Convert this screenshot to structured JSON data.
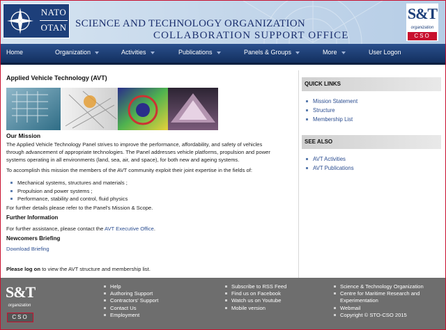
{
  "header": {
    "nato_line1": "NATO",
    "nato_line2": "OTAN",
    "org_line1": "SCIENCE AND TECHNOLOGY ORGANIZATION",
    "org_line2": "COLLABORATION SUPPORT OFFICE",
    "logo_mark": "S&T",
    "logo_org": "organization",
    "logo_cso": "CSO"
  },
  "nav": {
    "items": [
      {
        "label": "Home",
        "dropdown": false
      },
      {
        "label": "Organization",
        "dropdown": true
      },
      {
        "label": "Activities",
        "dropdown": true
      },
      {
        "label": "Publications",
        "dropdown": true
      },
      {
        "label": "Panels & Groups",
        "dropdown": true
      },
      {
        "label": "More",
        "dropdown": true
      },
      {
        "label": "User Logon",
        "dropdown": false
      }
    ]
  },
  "main": {
    "title": "Applied Vehicle Technology (AVT)",
    "mission_heading": "Our Mission",
    "mission_p1_l1": "The Applied Vehicle Technology Panel strives to improve the performance, affordability, and safety of vehicles",
    "mission_p1_l2": "through advancement of appropriate technologies. The Panel addresses vehicle platforms, propulsion and power",
    "mission_p1_l3": "systems operating in all environments (land, sea, air, and space), for both new and ageing systems.",
    "mission_p2": "To accomplish this mission the members of the AVT community exploit their joint expertise in the fields of:",
    "fields": [
      "Mechanical systems, structures and materials ;",
      "Propulsion and power systems ;",
      "Performance, stability and control, fluid physics"
    ],
    "details_text": "For further details please refer to the Panel's Mission & Scope.",
    "further_info_heading": "Further Information",
    "assistance_prefix": "For further assistance, please contact the ",
    "assistance_link": "AVT Executive Office",
    "assistance_suffix": ".",
    "newcomers_heading": "Newcomers Briefing",
    "download_link": "Download Briefing",
    "login_bold": "Please log on",
    "login_rest": " to view the AVT structure and membership list."
  },
  "sidebar": {
    "quick_links_heading": "QUICK LINKS",
    "quick_links": [
      "Mission Statement",
      "Structure",
      "Membership List"
    ],
    "see_also_heading": "SEE ALSO",
    "see_also": [
      "AVT Activities",
      "AVT Publications"
    ]
  },
  "footer": {
    "logo_mark": "S&T",
    "logo_org": "organization",
    "logo_cso": "CSO",
    "col1": [
      "Help",
      "Authoring Support",
      "Contractors' Support",
      "Contact Us",
      "Employment"
    ],
    "col2": [
      "Subscribe to RSS Feed",
      "Find us on Facebook",
      "Watch us on Youtube",
      "Mobile version"
    ],
    "col3": [
      "Science & Technology Organization",
      "Centre for Maritime Research and",
      "Experimentation",
      "Webmail",
      "Copyright © STO-CSO 2015"
    ]
  },
  "colors": {
    "nav_bg": "#13305f",
    "brand_red": "#c8102e",
    "link": "#2c4e91",
    "footer_bg": "#6e6e6e"
  }
}
